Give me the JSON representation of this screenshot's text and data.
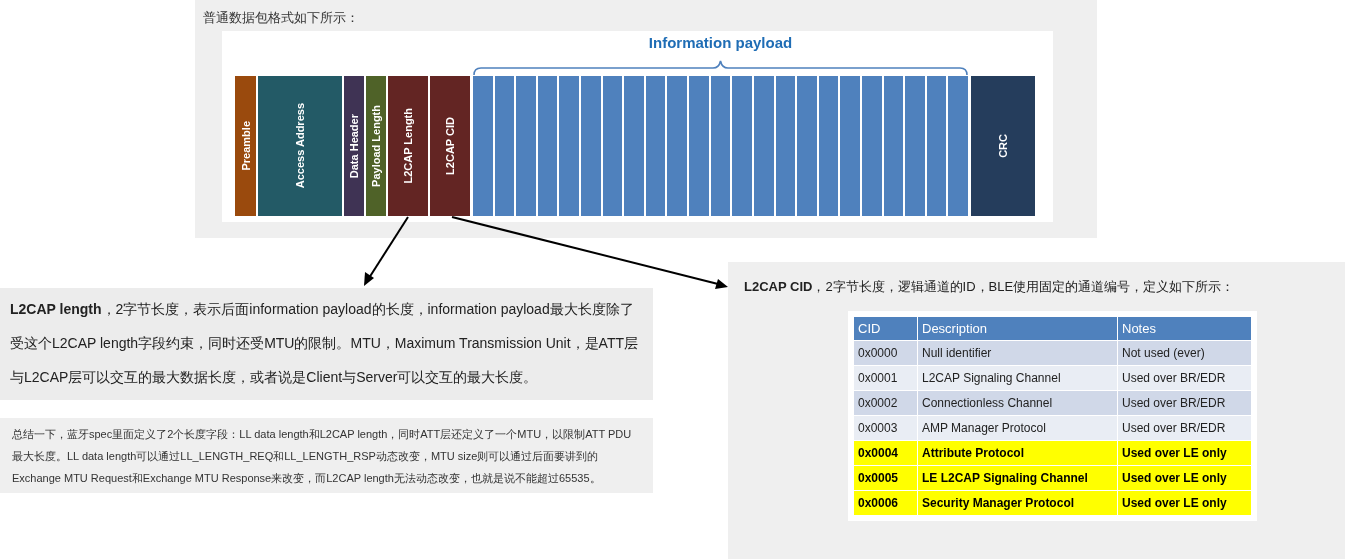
{
  "packet_panel": {
    "caption": "普通数据包格式如下所示：",
    "fields": [
      {
        "kind": "field",
        "label": "Preamble",
        "color": "#9a4a0d"
      },
      {
        "kind": "field",
        "label": "Access Address",
        "color": "#235a66"
      },
      {
        "kind": "field",
        "label": "Data Header",
        "color": "#3f3354"
      },
      {
        "kind": "field",
        "label": "Payload Length",
        "color": "#4f6228"
      },
      {
        "kind": "field",
        "label": "L2CAP Length",
        "color": "#632523"
      },
      {
        "kind": "field",
        "label": "L2CAP CID",
        "color": "#632523"
      },
      {
        "kind": "payload",
        "label": "Information payload",
        "color": "#4f81bd"
      },
      {
        "kind": "field",
        "label": "CRC",
        "color": "#253d5c"
      }
    ]
  },
  "length_note": "**L2CAP length**，2字节长度，表示后面information payload的长度，information payload最大长度除了受这个L2CAP length字段约束，同时还受MTU的限制。MTU，Maximum Transmission Unit，是ATT层与L2CAP层可以交互的最大数据长度，或者说是Client与Server可以交互的最大长度。",
  "summary": "总结一下，蓝牙spec里面定义了2个长度字段：LL data length和L2CAP length，同时ATT层还定义了一个MTU，以限制ATT PDU最大长度。LL data length可以通过LL_LENGTH_REQ和LL_LENGTH_RSP动态改变，MTU size则可以通过后面要讲到的Exchange MTU Request和Exchange MTU Response来改变，而L2CAP length无法动态改变，也就是说不能超过65535。",
  "cid_panel": {
    "heading": "**L2CAP CID**，2字节长度，逻辑通道的ID，BLE使用固定的通道编号，定义如下所示：",
    "table": {
      "columns": [
        "CID",
        "Description",
        "Notes"
      ],
      "rows": [
        {
          "cells": [
            "0x0000",
            "Null identifier",
            "Not used (ever)"
          ],
          "highlighted": false
        },
        {
          "cells": [
            "0x0001",
            "L2CAP Signaling Channel",
            "Used over BR/EDR"
          ],
          "highlighted": false
        },
        {
          "cells": [
            "0x0002",
            "Connectionless Channel",
            "Used over BR/EDR"
          ],
          "highlighted": false
        },
        {
          "cells": [
            "0x0003",
            "AMP Manager Protocol",
            "Used over BR/EDR"
          ],
          "highlighted": false
        },
        {
          "cells": [
            "0x0004",
            "Attribute Protocol",
            "Used over LE only"
          ],
          "highlighted": true
        },
        {
          "cells": [
            "0x0005",
            "LE L2CAP Signaling Channel",
            "Used over LE only"
          ],
          "highlighted": true
        },
        {
          "cells": [
            "0x0006",
            "Security Manager Protocol",
            "Used over LE only"
          ],
          "highlighted": true
        }
      ]
    }
  }
}
